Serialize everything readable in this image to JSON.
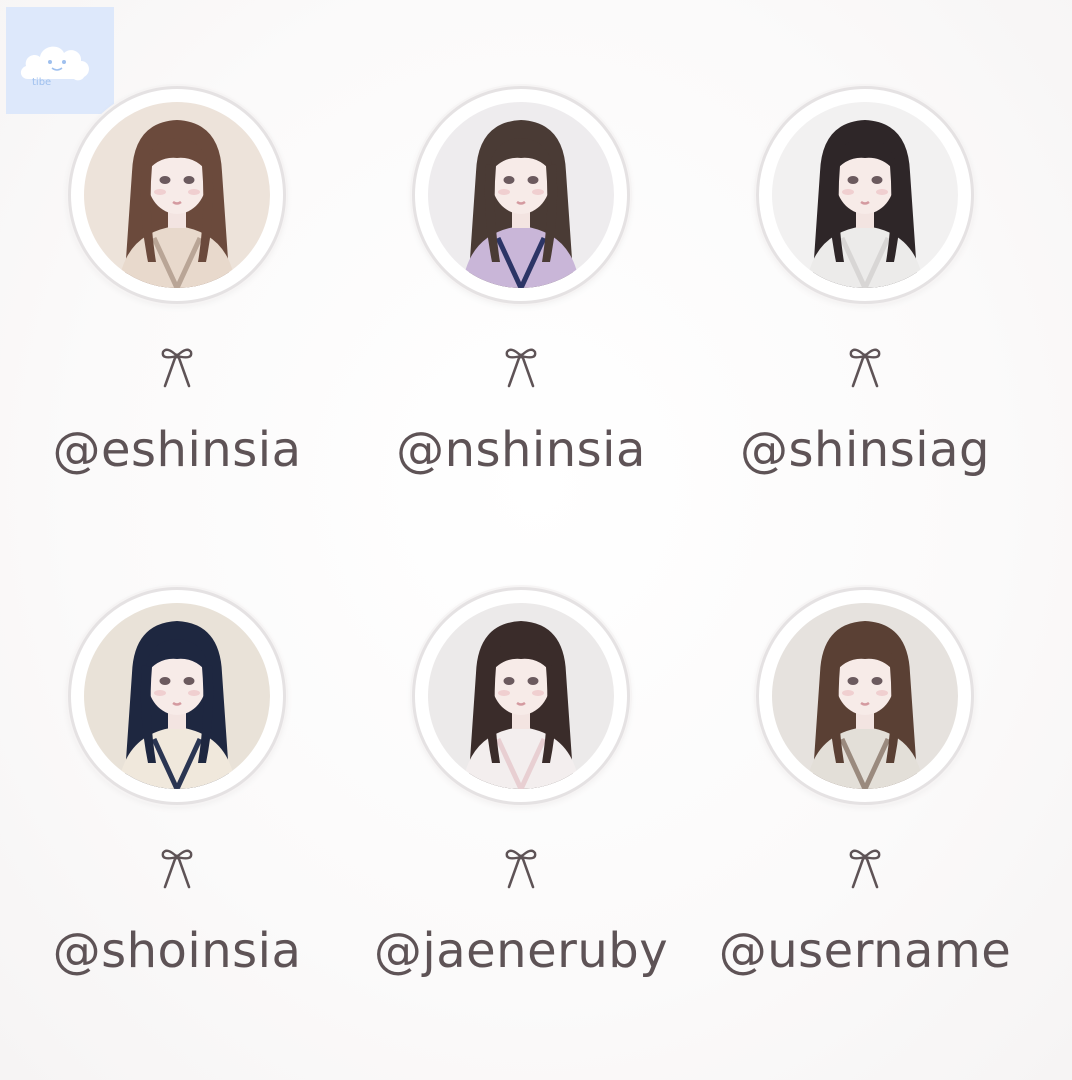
{
  "profiles": [
    {
      "handle": "@eshinsia",
      "hair": "#6b4a3c",
      "outfit": "#e8d9cc",
      "accent": "#b9a596",
      "bg": "#ede3da",
      "bow_icon": "ribbon-bow-icon"
    },
    {
      "handle": "@nshinsia",
      "hair": "#4a3b35",
      "outfit": "#c9b6d8",
      "accent": "#2c3566",
      "bg": "#eeecee",
      "bow_icon": "ribbon-bow-icon"
    },
    {
      "handle": "@shinsiag",
      "hair": "#2e2628",
      "outfit": "#ecebea",
      "accent": "#d8d6d5",
      "bg": "#f2f1f1",
      "bow_icon": "ribbon-bow-icon"
    },
    {
      "handle": "@shoinsia",
      "hair": "#1e2740",
      "outfit": "#f0e8dc",
      "accent": "#2a3552",
      "bg": "#e9e2d8",
      "bow_icon": "ribbon-bow-icon"
    },
    {
      "handle": "@jaeneruby",
      "hair": "#3a2c2a",
      "outfit": "#f3eeee",
      "accent": "#e8cfd2",
      "bg": "#eceaea",
      "bow_icon": "ribbon-bow-icon"
    },
    {
      "handle": "@username",
      "hair": "#5a4034",
      "outfit": "#e3dfd8",
      "accent": "#9a8a7e",
      "bg": "#e6e2de",
      "bow_icon": "ribbon-bow-icon"
    }
  ],
  "watermark": {
    "text": "tibe",
    "color": "#9fc0ee",
    "bg": "#dde8fb"
  }
}
